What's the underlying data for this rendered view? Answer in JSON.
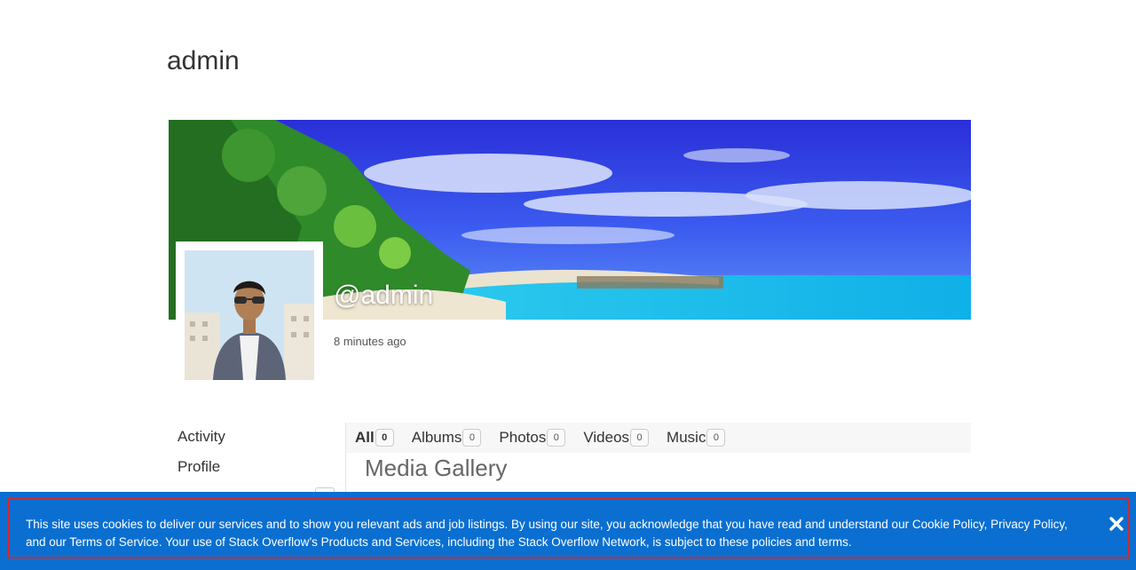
{
  "page": {
    "title": "admin"
  },
  "profile": {
    "handle": "@admin",
    "last_active": "8 minutes ago"
  },
  "nav": {
    "items": [
      {
        "label": "Activity"
      },
      {
        "label": "Profile"
      }
    ]
  },
  "media": {
    "tabs": [
      {
        "label": "All",
        "count": "0",
        "active": true
      },
      {
        "label": "Albums",
        "count": "0"
      },
      {
        "label": "Photos",
        "count": "0"
      },
      {
        "label": "Videos",
        "count": "0"
      },
      {
        "label": "Music",
        "count": "0"
      }
    ],
    "heading": "Media Gallery"
  },
  "cookie": {
    "text": "This site uses cookies to deliver our services and to show you relevant ads and job listings. By using our site, you acknowledge that you have read and understand our Cookie Policy, Privacy Policy, and our Terms of Service. Your use of Stack Overflow’s Products and Services, including the Stack Overflow Network, is subject to these policies and terms."
  },
  "colors": {
    "banner": "#0a6fd0",
    "banner_outline": "#d8262b"
  }
}
